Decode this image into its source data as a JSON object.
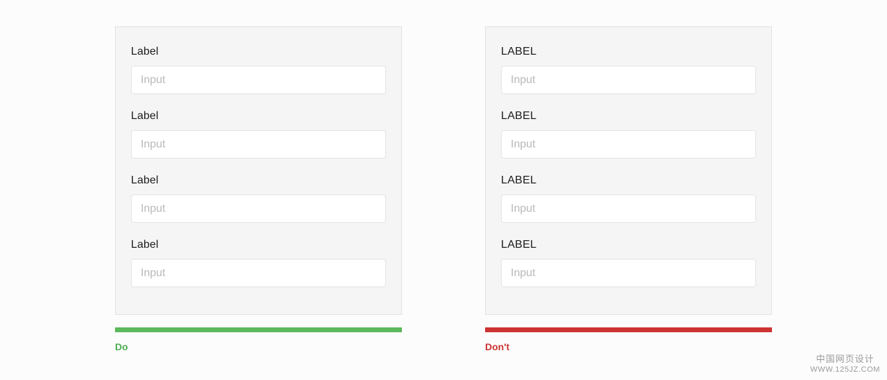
{
  "page": {
    "background_color": "#fcfcfc"
  },
  "examples": [
    {
      "variant": "good",
      "panel": {
        "background_color": "#f5f5f5",
        "border_color": "#e2e2e2"
      },
      "fields": [
        {
          "label": "Label",
          "value": "",
          "placeholder": "Input"
        },
        {
          "label": "Label",
          "value": "",
          "placeholder": "Input"
        },
        {
          "label": "Label",
          "value": "",
          "placeholder": "Input"
        },
        {
          "label": "Label",
          "value": "",
          "placeholder": "Input"
        }
      ],
      "verdict": {
        "text": "Do",
        "bar_color": "#5cb85c",
        "text_color": "#4caf50"
      }
    },
    {
      "variant": "bad",
      "panel": {
        "background_color": "#f5f5f5",
        "border_color": "#e2e2e2"
      },
      "fields": [
        {
          "label": "LABEL",
          "value": "",
          "placeholder": "Input"
        },
        {
          "label": "LABEL",
          "value": "",
          "placeholder": "Input"
        },
        {
          "label": "LABEL",
          "value": "",
          "placeholder": "Input"
        },
        {
          "label": "LABEL",
          "value": "",
          "placeholder": "Input"
        }
      ],
      "verdict": {
        "text": "Don't",
        "bar_color": "#cc3333",
        "text_color": "#cc3333"
      }
    }
  ],
  "watermark": {
    "line1": "中国网页设计",
    "line2": "WWW.125JZ.COM"
  }
}
